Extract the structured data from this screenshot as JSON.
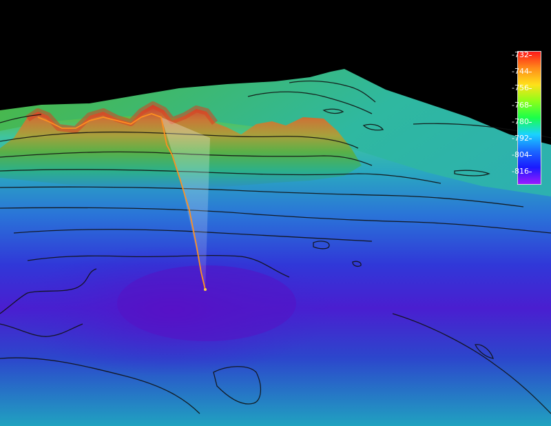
{
  "colors": {
    "background": "#000000",
    "high": "#ff1a1a",
    "mid": "#22ff22",
    "low": "#1a1aff",
    "lowest": "#9b1aff",
    "contour": "#111111",
    "profile_line": "#ff9020"
  },
  "legend": {
    "ticks": [
      "-732",
      "-744",
      "-756",
      "-768",
      "-780",
      "-792",
      "-804",
      "-816"
    ],
    "gradient": [
      "#ff1a1a",
      "#ff8c1a",
      "#ffe11a",
      "#8cff1a",
      "#1aff4a",
      "#1ad2ff",
      "#1a6aff",
      "#1a1aff",
      "#9b1aff"
    ]
  }
}
